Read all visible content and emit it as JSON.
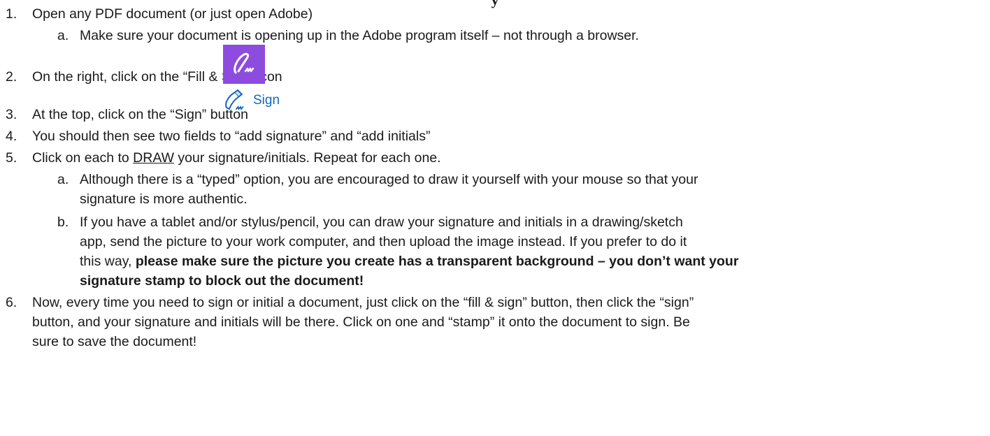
{
  "title_fragment": "y",
  "steps": [
    {
      "num": "1.",
      "text": "Open any PDF document (or just open Adobe)",
      "sub": [
        {
          "letter": "a.",
          "text": "Make sure your document is opening up in the Adobe program itself – not through a browser."
        }
      ]
    },
    {
      "num": "2.",
      "text": "On the right, click on the “Fill & Sign” icon",
      "icon": "fill-sign-icon"
    },
    {
      "num": "3.",
      "text": "At the top, click on the “Sign” button",
      "button_label": "Sign",
      "button_icon": "pen-sign-icon"
    },
    {
      "num": "4.",
      "text": "You should then see two fields to “add signature” and “add initials”"
    },
    {
      "num": "5.",
      "text_pre": "Click on each to ",
      "text_u": "DRAW",
      "text_post": " your signature/initials. Repeat for each one.",
      "sub": [
        {
          "letter": "a.",
          "lines": [
            "Although there is a “typed” option, you are encouraged to draw it yourself with your mouse so that your",
            "signature is more authentic."
          ]
        },
        {
          "letter": "b.",
          "lines": [
            "If you have a tablet and/or stylus/pencil, you can draw your signature and initials in a drawing/sketch",
            "app, send the picture to your work computer, and then upload the image instead. If you prefer to do it"
          ],
          "line3_pre": "this way, ",
          "line3_bold": "please make sure the picture you create has a transparent background – you don’t want your",
          "line4_bold": "signature stamp to block out the document!"
        }
      ]
    },
    {
      "num": "6.",
      "lines": [
        "Now, every time you need to sign or initial a document, just click on the “fill & sign” button, then click the “sign”",
        "button, and your signature and initials will be there. Click on one and “stamp” it onto the document to sign. Be",
        "sure to save the document!"
      ]
    }
  ]
}
